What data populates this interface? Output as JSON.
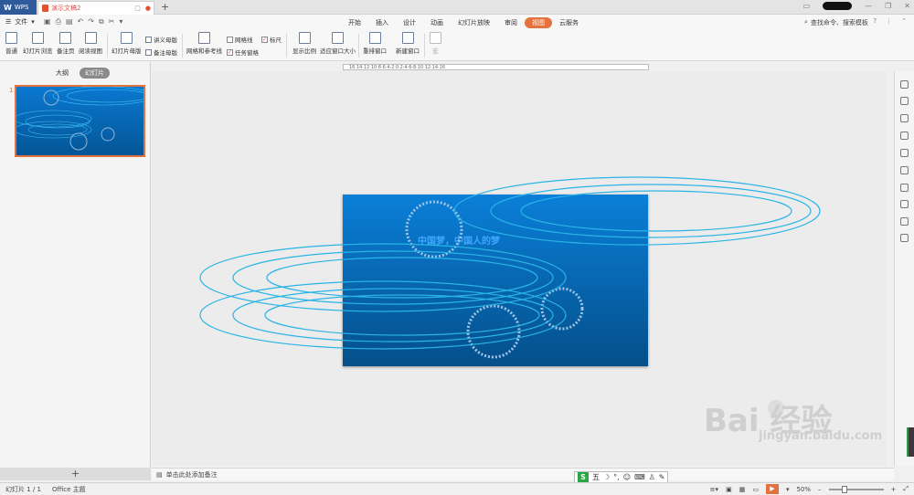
{
  "titlebar": {
    "app_label": "WPS",
    "doc_tab": "演示文稿2",
    "new_tab": "+"
  },
  "ribbon_tabs": {
    "file": "文件",
    "tabs": [
      "开始",
      "插入",
      "设计",
      "动画",
      "幻灯片放映",
      "审阅",
      "视图",
      "云服务"
    ],
    "active": "视图",
    "search": "查找命令、搜索模板",
    "help": "?"
  },
  "ribbon": {
    "normal": "普通",
    "sorter": "幻灯片浏览",
    "notes_page": "备注页",
    "reading": "阅读视图",
    "master": "幻灯片母版",
    "handout_master": "讲义母版",
    "notes_master": "备注母版",
    "grid_guides": "网格和参考线",
    "gridlines": "网格线",
    "ruler": "标尺",
    "taskpane": "任务窗格",
    "zoom": "显示比例",
    "fit_window": "适应窗口大小",
    "rearrange": "重排窗口",
    "new_window": "新建窗口",
    "macro": "宏"
  },
  "ruler": {
    "ticks": "16·14·12·10·8·6·4·2·0·2·4·6·8·10·12·14·16"
  },
  "left_panel": {
    "tab_outline": "大纲",
    "tab_slides": "幻灯片",
    "slide_number": "1",
    "add": "+"
  },
  "slide": {
    "title": "中国梦，中国人的梦"
  },
  "notes": {
    "placeholder": "单击此处添加备注"
  },
  "ime": {
    "logo": "S",
    "items": [
      "五",
      "☽",
      "°,",
      "☺",
      "⌨",
      "♙",
      "✎"
    ]
  },
  "status": {
    "slide_count": "幻灯片 1 / 1",
    "theme": "Office 主题",
    "zoom": "50%",
    "minus": "–",
    "plus": "+"
  },
  "watermark": {
    "brand": "Bai",
    "brand2": "经验",
    "url": "jingyan.baidu.com"
  }
}
